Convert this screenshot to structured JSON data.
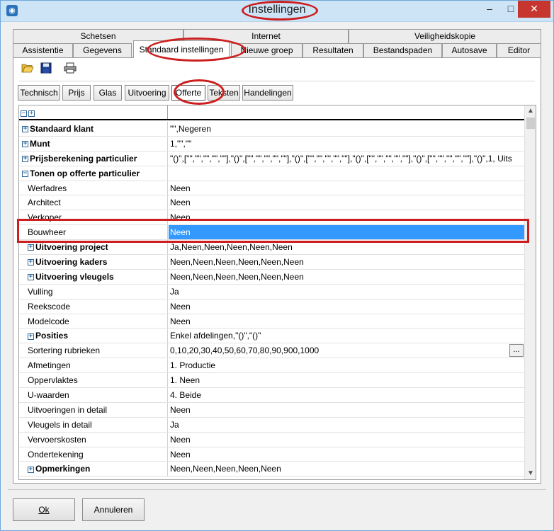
{
  "window": {
    "title": "Instellingen",
    "app_icon": "gear-app-icon",
    "min_label": "–",
    "max_label": "□",
    "close_label": "✕"
  },
  "tabs": {
    "row1": [
      {
        "label": "Schetsen"
      },
      {
        "label": "Internet"
      },
      {
        "label": "Veiligheidskopie"
      }
    ],
    "row2": [
      {
        "label": "Assistentie"
      },
      {
        "label": "Gegevens"
      },
      {
        "label": "Standaard instellingen",
        "active": true
      },
      {
        "label": "Nieuwe groep"
      },
      {
        "label": "Resultaten"
      },
      {
        "label": "Bestandspaden"
      },
      {
        "label": "Autosave"
      },
      {
        "label": "Editor"
      }
    ]
  },
  "toolbar": {
    "open_icon": "folder-open-icon",
    "save_icon": "floppy-save-icon",
    "print_icon": "printer-icon"
  },
  "subtabs": [
    {
      "label": "Technisch"
    },
    {
      "label": "Prijs"
    },
    {
      "label": "Glas"
    },
    {
      "label": "Uitvoering"
    },
    {
      "label": "Offerte",
      "active": true
    },
    {
      "label": "Teksten"
    },
    {
      "label": "Handelingen"
    }
  ],
  "grid": {
    "header_icons": "collapse-expand-all-icons",
    "rows": [
      {
        "name": "Standaard klant",
        "value": "\"\",Negeren",
        "type": "group",
        "expander": "+"
      },
      {
        "name": "Munt",
        "value": "1,\"\",\"\"",
        "type": "group",
        "expander": "+"
      },
      {
        "name": "Prijsberekening particulier",
        "value": "\"()\",[\"\",\"\",\"\",\"\",\"\"],\"()\",[\"\",\"\",\"\",\"\",\"\"],\"()\",[\"\",\"\",\"\",\"\",\"\"],\"()\",[\"\",\"\",\"\",\"\",\"\"],\"()\",[\"\",\"\",\"\",\"\",\"\"],\"()\",1, Uits",
        "type": "group",
        "expander": "+"
      },
      {
        "name": "Tonen op offerte particulier",
        "value": "",
        "type": "group",
        "expander": "−"
      },
      {
        "name": "Werfadres",
        "value": "Neen",
        "type": "item"
      },
      {
        "name": "Architect",
        "value": "Neen",
        "type": "item"
      },
      {
        "name": "Verkoper",
        "value": "Neen",
        "type": "item"
      },
      {
        "name": "Bouwheer",
        "value": "Neen",
        "type": "item",
        "selected": true
      },
      {
        "name": "Uitvoering project",
        "value": "Ja,Neen,Neen,Neen,Neen,Neen",
        "type": "subgroup",
        "expander": "+"
      },
      {
        "name": "Uitvoering kaders",
        "value": "Neen,Neen,Neen,Neen,Neen,Neen",
        "type": "subgroup",
        "expander": "+"
      },
      {
        "name": "Uitvoering vleugels",
        "value": "Neen,Neen,Neen,Neen,Neen,Neen",
        "type": "subgroup",
        "expander": "+"
      },
      {
        "name": "Vulling",
        "value": "Ja",
        "type": "item"
      },
      {
        "name": "Reekscode",
        "value": "Neen",
        "type": "item"
      },
      {
        "name": "Modelcode",
        "value": "Neen",
        "type": "item"
      },
      {
        "name": "Posities",
        "value": "Enkel afdelingen,\"()\",\"()\"",
        "type": "subgroup",
        "expander": "+"
      },
      {
        "name": "Sortering rubrieken",
        "value": "0,10,20,30,40,50,60,70,80,90,900,1000",
        "type": "item",
        "has_button": true,
        "button_label": "..."
      },
      {
        "name": "Afmetingen",
        "value": "1. Productie",
        "type": "item"
      },
      {
        "name": "Oppervlaktes",
        "value": "1. Neen",
        "type": "item"
      },
      {
        "name": "U-waarden",
        "value": "4. Beide",
        "type": "item"
      },
      {
        "name": "Uitvoeringen in detail",
        "value": "Neen",
        "type": "item"
      },
      {
        "name": "Vleugels in detail",
        "value": "Ja",
        "type": "item"
      },
      {
        "name": "Vervoerskosten",
        "value": "Neen",
        "type": "item"
      },
      {
        "name": "Ondertekening",
        "value": "Neen",
        "type": "item"
      },
      {
        "name": "Opmerkingen",
        "value": "Neen,Neen,Neen,Neen,Neen",
        "type": "subgroup",
        "expander": "+"
      }
    ]
  },
  "buttons": {
    "ok": "Ok",
    "cancel": "Annuleren"
  },
  "colors": {
    "selection": "#3399ff",
    "highlight_annotation": "#cc1e1e",
    "titlebar": "#cde4f7"
  }
}
